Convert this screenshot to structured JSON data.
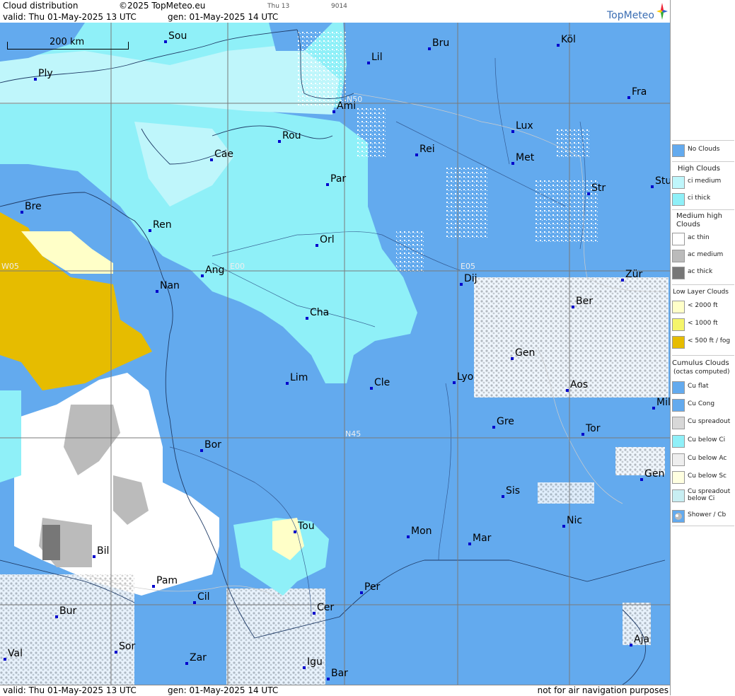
{
  "header": {
    "title": "Cloud distribution",
    "copyright": "©2025 TopMeteo.eu",
    "frame_day": "Thu 13",
    "frame_code": "9014",
    "valid_line": "valid:  Thu  01-May-2025  13 UTC",
    "gen_line": "gen: 01-May-2025 14 UTC",
    "brand": "TopMeteo"
  },
  "footer": {
    "valid_line": "valid:  Thu  01-May-2025  13 UTC",
    "gen_line": "gen: 01-May-2025 14 UTC",
    "disclaimer": "not for air navigation purposes"
  },
  "map": {
    "scale_label": "200 km",
    "grid_labels": [
      "E00",
      "E05",
      "W05",
      "N45",
      "N50"
    ],
    "cities": [
      "Sou",
      "Lil",
      "Bru",
      "Köl",
      "Ply",
      "Ami",
      "Fra",
      "Lux",
      "Rou",
      "Cae",
      "Rei",
      "Met",
      "Par",
      "Str",
      "Stu",
      "Bre",
      "Ren",
      "Orl",
      "Ang",
      "Nan",
      "Dij",
      "Zür",
      "Cha",
      "Ber",
      "Gen",
      "Lim",
      "Cle",
      "Lyo",
      "Aos",
      "Mil",
      "Gre",
      "Tor",
      "Bor",
      "Gen",
      "Sis",
      "Tou",
      "Mon",
      "Mar",
      "Nic",
      "Bil",
      "Pam",
      "Cil",
      "Per",
      "Cer",
      "Bur",
      "Sor",
      "Val",
      "Zar",
      "Igu",
      "Bar",
      "Aja"
    ]
  },
  "legend": {
    "no_clouds": "No Clouds",
    "high_title": "High Clouds",
    "ci_medium": "ci medium",
    "ci_thick": "ci thick",
    "medium_title": "Medium high Clouds",
    "ac_thin": "ac thin",
    "ac_medium": "ac medium",
    "ac_thick": "ac thick",
    "low_title": "Low Layer Clouds",
    "low_2000": "< 2000 ft",
    "low_1000": "< 1000 ft",
    "low_500": "< 500 ft / fog",
    "cu_title": "Cumulus Clouds",
    "cu_subtitle": "(octas computed)",
    "cu_flat": "Cu flat",
    "cu_cong": "Cu Cong",
    "cu_spreadout": "Cu spreadout",
    "cu_below_ci": "Cu below Ci",
    "cu_below_ac": "Cu below Ac",
    "cu_below_sc": "Cu below Sc",
    "cu_spreadout_below_ci": "Cu spreadout below Ci",
    "shower_cb": "Shower / Cb"
  },
  "colors": {
    "no_clouds": "#63aaee",
    "ci_medium": "#bff6fb",
    "ci_thick": "#8ff0f8",
    "ac_thin": "#ffffff",
    "ac_medium": "#bbbbbb",
    "ac_thick": "#777777",
    "low_2000": "#ffffc8",
    "low_1000": "#f5f56a",
    "low_500": "#e6bc00"
  }
}
